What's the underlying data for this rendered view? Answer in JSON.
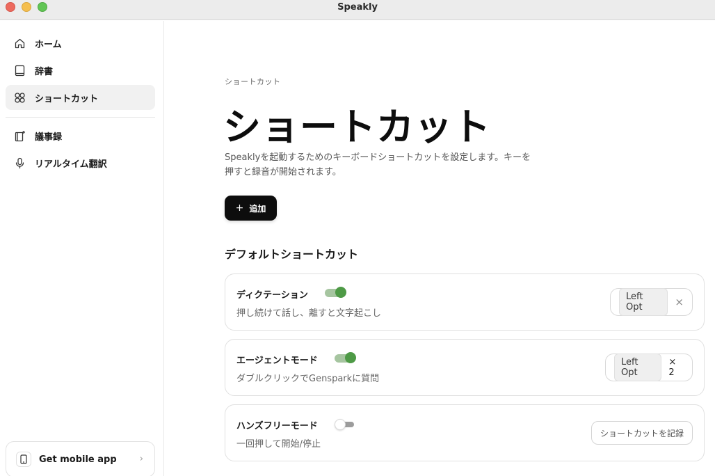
{
  "window": {
    "title": "Speakly"
  },
  "sidebar": {
    "items": [
      {
        "label": "ホーム",
        "icon": "home-icon"
      },
      {
        "label": "辞書",
        "icon": "book-icon"
      },
      {
        "label": "ショートカット",
        "icon": "shortcut-icon",
        "active": true
      },
      {
        "label": "議事録",
        "icon": "document-sparkle-icon"
      },
      {
        "label": "リアルタイム翻訳",
        "icon": "microphone-icon"
      }
    ],
    "mobile_app": {
      "label": "Get mobile app",
      "icon": "phone-icon",
      "chevron": "›"
    }
  },
  "main": {
    "breadcrumb": "ショートカット",
    "title": "ショートカット",
    "description_line1": "Speaklyを起動するためのキーボードショートカットを設定します。キーを",
    "description_line2": "押すと録音が開始されます。",
    "add_button": {
      "icon": "+",
      "label": "追加"
    },
    "section_title": "デフォルトショートカット",
    "shortcuts": [
      {
        "title": "ディクテーション",
        "description": "押し続けて話し、離すと文字起こし",
        "enabled": true,
        "key": "Left Opt",
        "action": "×"
      },
      {
        "title": "エージェントモード",
        "description": "ダブルクリックでGensparkに質問",
        "enabled": true,
        "key": "Left Opt",
        "multiplier": "× 2"
      },
      {
        "title": "ハンズフリーモード",
        "description": "一回押して開始/停止",
        "enabled": false,
        "record_label": "ショートカットを記録"
      }
    ]
  },
  "colors": {
    "accent_green": "#4e9a46",
    "button_dark": "#0d0d0d"
  }
}
